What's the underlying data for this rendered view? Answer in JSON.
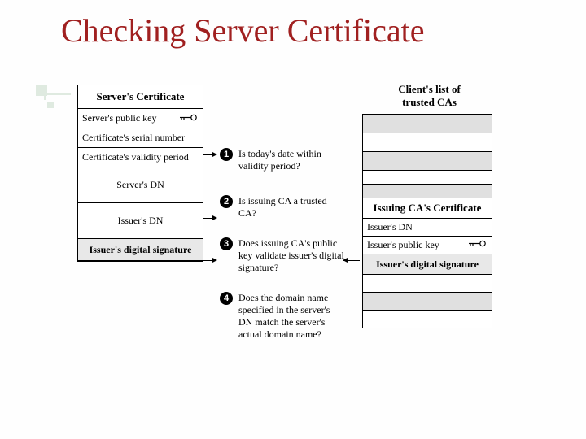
{
  "title": "Checking Server Certificate",
  "server_cert": {
    "header": "Server's Certificate",
    "public_key": "Server's public key",
    "serial": "Certificate's serial number",
    "validity": "Certificate's validity period",
    "server_dn": "Server's DN",
    "issuer_dn": "Issuer's DN",
    "signature": "Issuer's digital signature"
  },
  "steps": {
    "s1": {
      "num": "1",
      "text": "Is today's date within validity period?"
    },
    "s2": {
      "num": "2",
      "text": "Is issuing CA a trusted CA?"
    },
    "s3": {
      "num": "3",
      "text": "Does issuing CA's public key validate issuer's digital signature?"
    },
    "s4": {
      "num": "4",
      "text": "Does the domain name specified in the server's DN match the server's actual domain name?"
    }
  },
  "client": {
    "header": "Client's list of trusted CAs"
  },
  "issuing": {
    "header": "Issuing CA's Certificate",
    "issuer_dn": "Issuer's DN",
    "public_key": "Issuer's public key",
    "signature": "Issuer's digital signature"
  }
}
